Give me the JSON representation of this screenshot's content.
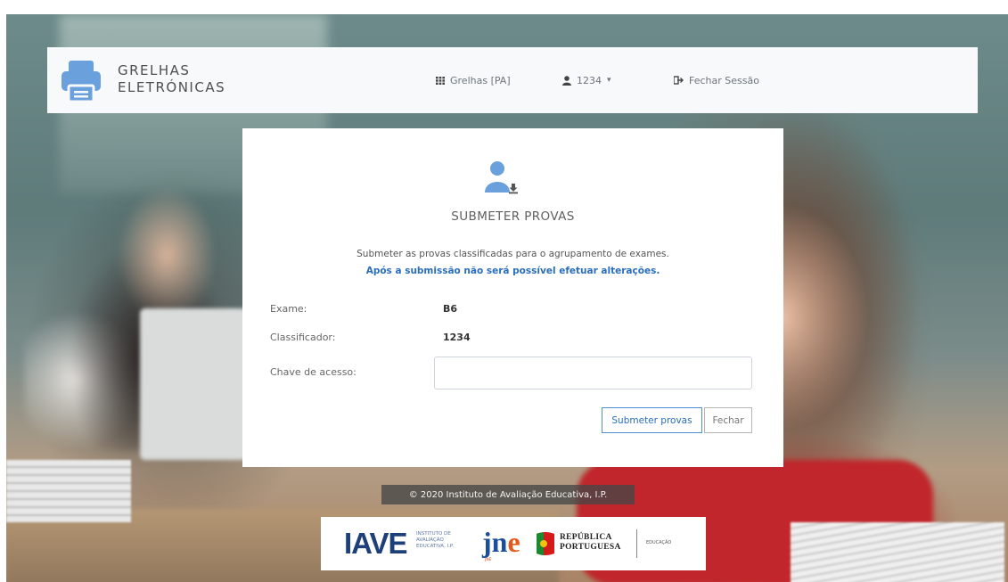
{
  "navbar": {
    "brand_line1": "GRELHAS",
    "brand_line2": "ELETRÓNICAS",
    "grelhas_label": "Grelhas [PA]",
    "user_label": "1234",
    "user_caret": "▾",
    "logout_label": "Fechar Sessão",
    "icons": {
      "brand": "printer-icon",
      "grelhas": "grid-icon",
      "user": "user-icon",
      "logout": "sign-out-icon"
    }
  },
  "modal": {
    "icon": "user-download-icon",
    "title": "SUBMETER PROVAS",
    "description": "Submeter as provas classificadas para o agrupamento de exames.",
    "warning": "Após a submissão não será possível efetuar alterações.",
    "fields": {
      "exame_label": "Exame:",
      "exame_value": "B6",
      "classificador_label": "Classificador:",
      "classificador_value": "1234",
      "chave_label": "Chave de acesso:",
      "chave_value": "",
      "chave_placeholder": ""
    },
    "buttons": {
      "submit": "Submeter provas",
      "close": "Fechar"
    }
  },
  "footer": {
    "copyright": "© 2020 Instituto de Avaliação Educativa, I.P.",
    "logos": {
      "iave": "IAVE",
      "iave_sub": "INSTITUTO DE AVALIAÇÃO EDUCATIVA, I.P.",
      "jne_j": "j",
      "jne_n": "n",
      "jne_e": "e",
      "jne_sub": "JNE",
      "republica_line1": "REPÚBLICA",
      "republica_line2": "PORTUGUESA",
      "ministry": "EDUCAÇÃO"
    }
  },
  "colors": {
    "accent": "#2a6ebb",
    "brand_icon": "#6aa0dc",
    "navbar_bg": "#f8f9fa"
  }
}
